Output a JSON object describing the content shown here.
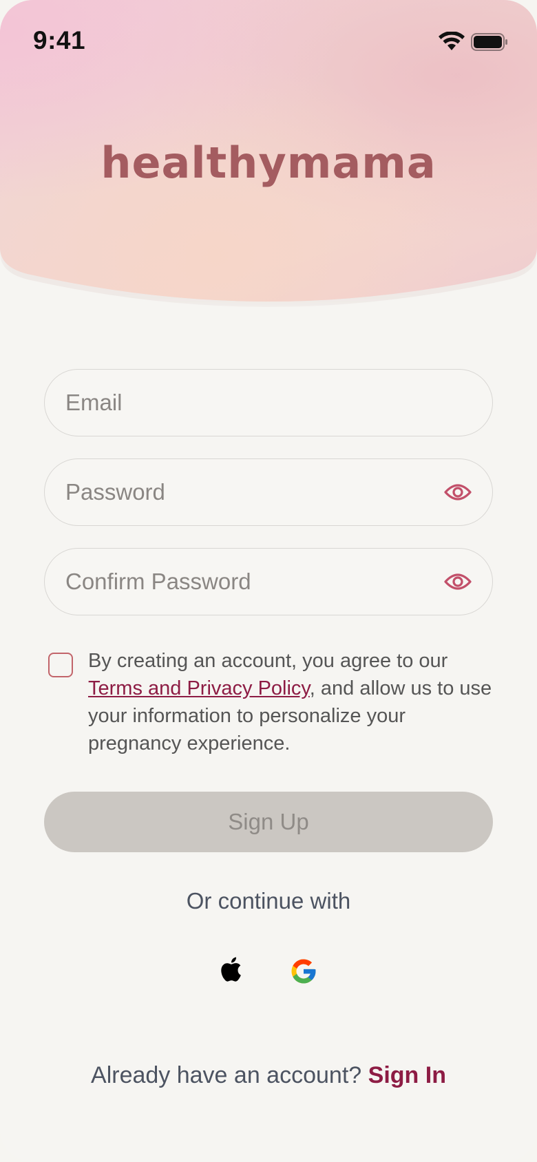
{
  "status_bar": {
    "time": "9:41"
  },
  "brand": {
    "logo_text": "healthymama"
  },
  "form": {
    "email_placeholder": "Email",
    "password_placeholder": "Password",
    "confirm_password_placeholder": "Confirm Password",
    "consent_prefix": "By creating an account, you agree to our ",
    "consent_link": "Terms and Privacy Policy",
    "consent_suffix": ", and allow us to use your information to personalize your pregnancy experience.",
    "consent_checked": false,
    "signup_label": "Sign Up"
  },
  "social": {
    "or_text": "Or continue with",
    "providers": [
      "apple-icon",
      "google-icon"
    ]
  },
  "footer": {
    "prompt": "Already have an account?",
    "signin_label": "Sign In"
  },
  "colors": {
    "accent": "#8d1c44",
    "logo": "#a45c60",
    "eye": "#c2506a",
    "disabled_button": "#cbc7c2"
  }
}
